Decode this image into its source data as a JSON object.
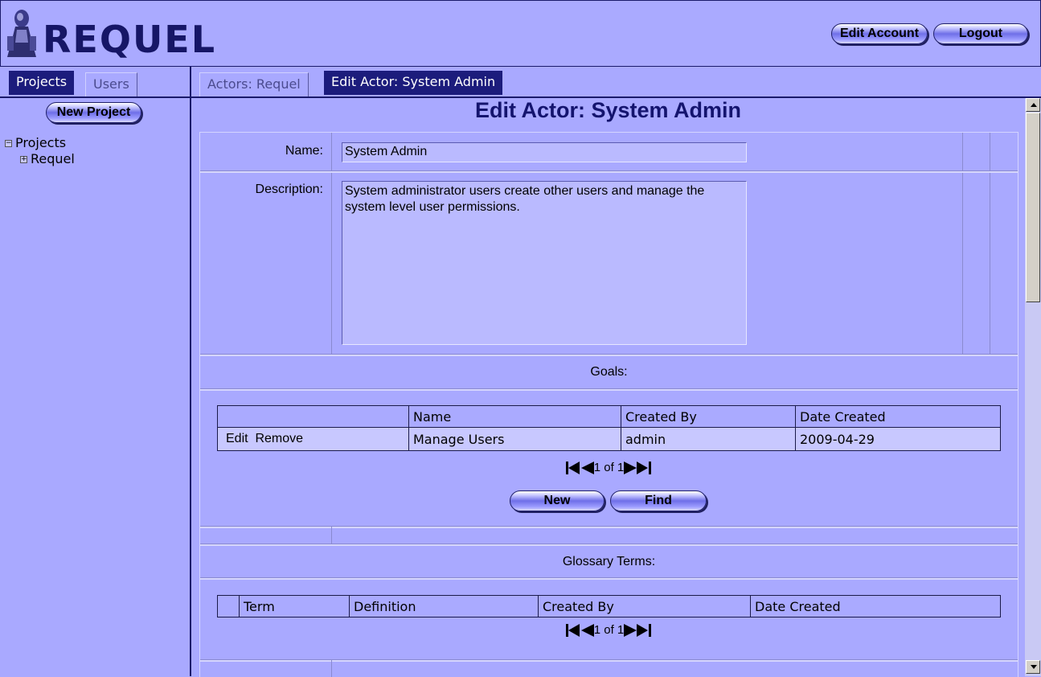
{
  "header": {
    "logo_text": "REQUEL",
    "edit_account_label": "Edit Account",
    "logout_label": "Logout"
  },
  "sidebar": {
    "tabs": [
      {
        "label": "Projects",
        "active": true
      },
      {
        "label": "Users",
        "active": false
      }
    ],
    "new_project_label": "New Project",
    "tree": {
      "root_label": "Projects",
      "root_expander": "−",
      "children": [
        {
          "label": "Requel",
          "expander": "+"
        }
      ]
    }
  },
  "content": {
    "tabs": [
      {
        "label": "Actors: Requel",
        "active": false
      },
      {
        "label": "Edit Actor: System Admin",
        "active": true
      }
    ],
    "title": "Edit Actor: System Admin",
    "form": {
      "name_label": "Name:",
      "name_value": "System Admin",
      "description_label": "Description:",
      "description_value": "System administrator users create other users and manage the system level user permissions."
    },
    "goals": {
      "section_label": "Goals:",
      "columns": [
        "",
        "Name",
        "Created By",
        "Date Created"
      ],
      "rows": [
        {
          "edit": "Edit",
          "remove": "Remove",
          "name": "Manage Users",
          "created_by": "admin",
          "date_created": "2009-04-29"
        }
      ],
      "pager_text": "1 of 1",
      "new_label": "New",
      "find_label": "Find"
    },
    "glossary": {
      "section_label": "Glossary Terms:",
      "columns": [
        "",
        "Term",
        "Definition",
        "Created By",
        "Date Created"
      ],
      "pager_text": "1 of 1"
    }
  },
  "colors": {
    "background": "#a9a9ff",
    "dark_navy": "#1c1c7c",
    "title_text": "#14146e",
    "input_fill": "#babaff"
  }
}
